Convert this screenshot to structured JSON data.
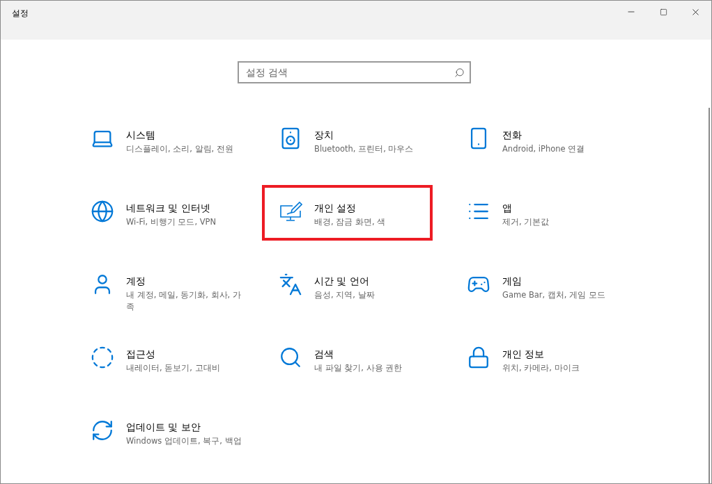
{
  "window": {
    "title": "설정"
  },
  "search": {
    "placeholder": "설정 검색"
  },
  "items": [
    {
      "title": "시스템",
      "description": "디스플레이, 소리, 알림, 전원",
      "highlighted": false
    },
    {
      "title": "장치",
      "description": "Bluetooth, 프린터, 마우스",
      "highlighted": false
    },
    {
      "title": "전화",
      "description": "Android, iPhone 연결",
      "highlighted": false
    },
    {
      "title": "네트워크 및 인터넷",
      "description": "Wi-Fi, 비행기 모드, VPN",
      "highlighted": false
    },
    {
      "title": "개인 설정",
      "description": "배경, 잠금 화면, 색",
      "highlighted": true
    },
    {
      "title": "앱",
      "description": "제거, 기본값",
      "highlighted": false
    },
    {
      "title": "계정",
      "description": "내 계정, 메일, 동기화, 회사, 가족",
      "highlighted": false
    },
    {
      "title": "시간 및 언어",
      "description": "음성, 지역, 날짜",
      "highlighted": false
    },
    {
      "title": "게임",
      "description": "Game Bar, 캡처, 게임 모드",
      "highlighted": false
    },
    {
      "title": "접근성",
      "description": "내레이터, 돋보기, 고대비",
      "highlighted": false
    },
    {
      "title": "검색",
      "description": "내 파일 찾기, 사용 권한",
      "highlighted": false
    },
    {
      "title": "개인 정보",
      "description": "위치, 카메라, 마이크",
      "highlighted": false
    },
    {
      "title": "업데이트 및 보안",
      "description": "Windows 업데이트, 복구, 백업",
      "highlighted": false
    }
  ]
}
